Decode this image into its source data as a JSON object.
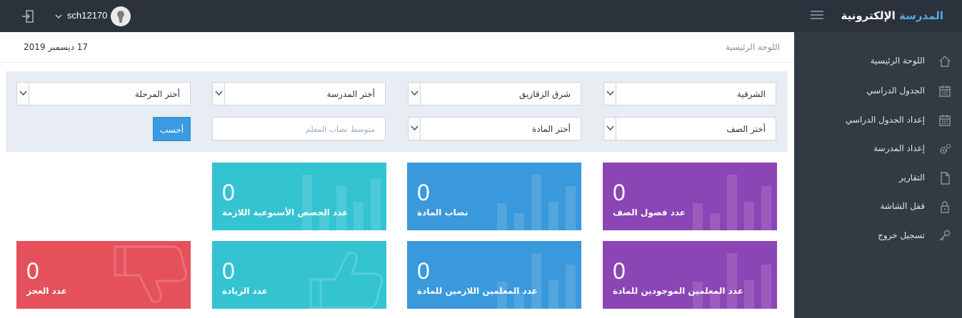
{
  "header": {
    "brand_accent": "المدرسة",
    "brand_rest": " الإلكترونية",
    "username": "sch12170"
  },
  "sidebar": {
    "items": [
      {
        "label": "اللوحة الرئيسية",
        "icon": "home-icon"
      },
      {
        "label": "الجدول الدراسي",
        "icon": "calendar-icon"
      },
      {
        "label": "إعداد الجدول الدراسي",
        "icon": "calendar-icon"
      },
      {
        "label": "إعداد المدرسة",
        "icon": "gears-icon"
      },
      {
        "label": "التقارير",
        "icon": "document-icon"
      },
      {
        "label": "قفل الشاشة",
        "icon": "lock-icon"
      },
      {
        "label": "تسجيل خروج",
        "icon": "key-icon"
      }
    ]
  },
  "page": {
    "breadcrumb": "اللوحة الرئيسية",
    "date": "17 ديسمبر 2019"
  },
  "filters": {
    "governorate": "الشرقية",
    "district": "شرق الزقازيق",
    "school": "أختر المدرسة",
    "stage": "أختر المرحلة",
    "grade": "أختر الصف",
    "subject": "أختر المادة",
    "teacher_load_placeholder": "متوسط نصاب المعلم",
    "calculate_label": "أحسب"
  },
  "stats": [
    {
      "value": "0",
      "label": "عدد فصول الصف",
      "color": "#8c45b5"
    },
    {
      "value": "0",
      "label": "نصاب المادة",
      "color": "#3a98dc"
    },
    {
      "value": "0",
      "label": "عدد الحصص الأسبوعية اللازمة",
      "color": "#33c3d1"
    },
    {
      "value": "0",
      "label": "عدد المعلمين الموجودين للمادة",
      "color": "#8c45b5"
    },
    {
      "value": "0",
      "label": "عدد المعلمين اللازمين للمادة",
      "color": "#3a98dc"
    },
    {
      "value": "0",
      "label": "عدد الزيادة",
      "color": "#33c3d1"
    },
    {
      "value": "0",
      "label": "عدد العجز",
      "color": "#e5515b"
    }
  ]
}
